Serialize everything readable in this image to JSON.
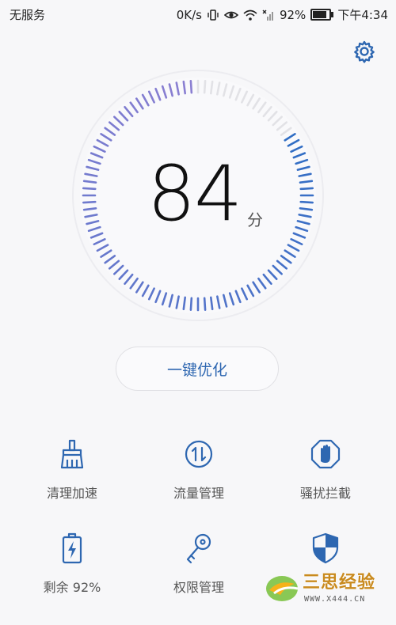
{
  "status_bar": {
    "carrier": "无服务",
    "speed": "0K/s",
    "battery_percent": "92%",
    "battery_level": 0.92,
    "time": "下午4:34"
  },
  "icons": {
    "settings": "gear-icon"
  },
  "score": {
    "value": "84",
    "unit": "分",
    "fraction": 0.84
  },
  "colors": {
    "accent": "#2e67b1",
    "tick_active_start": "#2f6dc4",
    "tick_active_end": "#8b7fd2",
    "tick_inactive": "#e2e2e6"
  },
  "optimize_button": {
    "label": "一键优化"
  },
  "features": [
    {
      "label": "清理加速",
      "icon": "broom-icon"
    },
    {
      "label": "流量管理",
      "icon": "data-transfer-icon"
    },
    {
      "label": "骚扰拦截",
      "icon": "hand-block-icon"
    },
    {
      "label": "剩余 92%",
      "icon": "battery-icon"
    },
    {
      "label": "权限管理",
      "icon": "key-icon"
    },
    {
      "label": "",
      "icon": "shield-icon"
    }
  ],
  "watermark": {
    "text": "三思经验",
    "url": "WWW.X444.CN"
  }
}
